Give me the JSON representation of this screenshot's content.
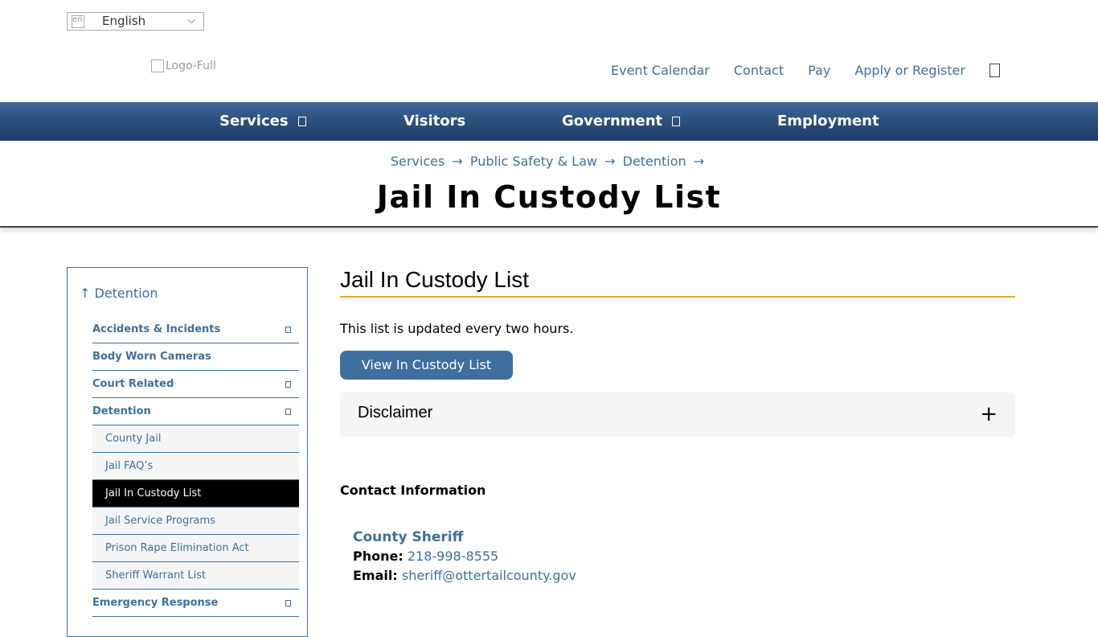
{
  "lang": {
    "flag_alt": "en",
    "label": "English"
  },
  "logo": {
    "alt": "Logo-Full"
  },
  "toplinks": [
    "Event Calendar",
    "Contact",
    "Pay",
    "Apply or Register"
  ],
  "nav": {
    "services": "Services",
    "visitors": "Visitors",
    "government": "Government",
    "employment": "Employment"
  },
  "breadcrumb": {
    "a": "Services",
    "b": "Public Safety & Law",
    "c": "Detention",
    "sep": "→"
  },
  "hero_title": "Jail In Custody List",
  "sidebar": {
    "up": "↑ Detention",
    "items": [
      {
        "label": "Accidents & Incidents"
      },
      {
        "label": "Body Worn Cameras"
      },
      {
        "label": "Court Related"
      },
      {
        "label": "Detention"
      }
    ],
    "subitems": [
      {
        "label": "County Jail"
      },
      {
        "label": "Jail FAQ’s"
      },
      {
        "label": "Jail In Custody List"
      },
      {
        "label": "Jail Service Programs"
      },
      {
        "label": "Prison Rape Elimination Act"
      },
      {
        "label": "Sheriff Warrant List"
      }
    ],
    "after": {
      "label": "Emergency Response"
    }
  },
  "content": {
    "title": "Jail In Custody List",
    "intro": "This list is updated every two hours.",
    "button": "View In Custody List",
    "disclaimer": "Disclaimer",
    "contact_heading": "Contact Information",
    "card": {
      "name": "County Sheriff",
      "phone_label": "Phone:",
      "phone": "218-998-8555",
      "email_label": "Email:",
      "email": "sheriff@ottertailcounty.gov"
    }
  },
  "colors": {
    "accent": "#3f6f9e",
    "rule": "#e8a33a",
    "nav": "#2a4d79"
  }
}
